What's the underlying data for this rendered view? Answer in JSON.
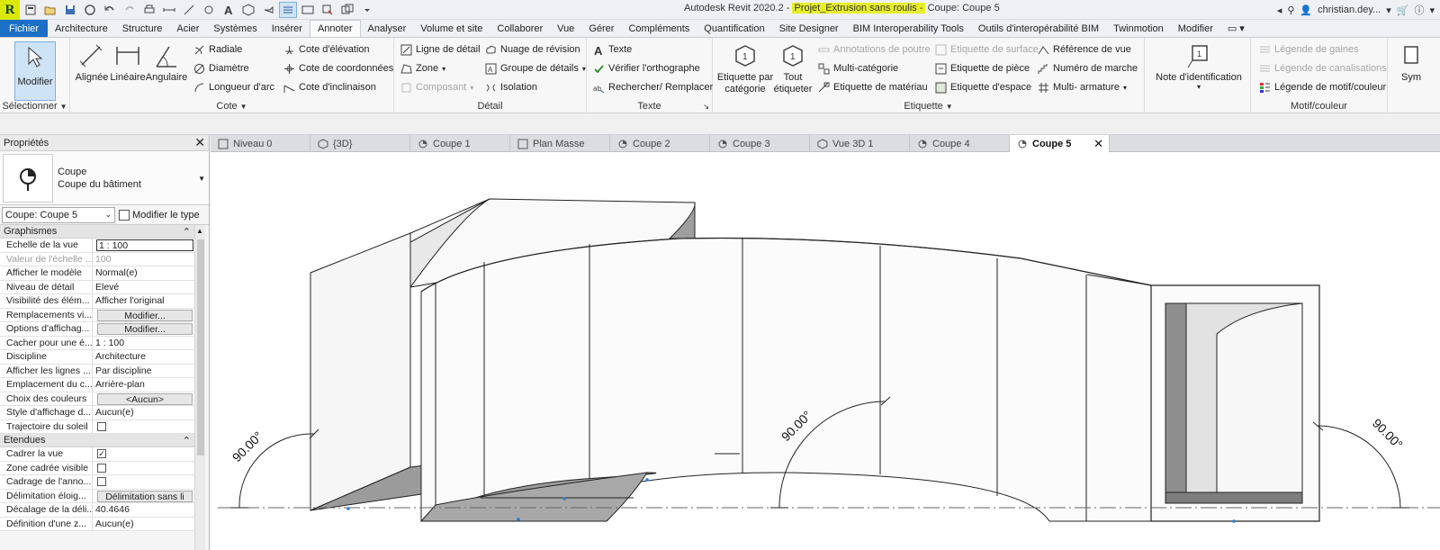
{
  "window": {
    "title_prefix": "Autodesk Revit 2020.2 - ",
    "title_project": "Projet_Extrusion sans roulis -",
    "title_view": " Coupe: Coupe 5",
    "user": "christian.dey...",
    "app_logo": "R"
  },
  "menu": [
    "Fichier",
    "Architecture",
    "Structure",
    "Acier",
    "Systèmes",
    "Insérer",
    "Annoter",
    "Analyser",
    "Volume et site",
    "Collaborer",
    "Vue",
    "Gérer",
    "Compléments",
    "Quantification",
    "Site Designer",
    "BIM Interoperability Tools",
    "Outils d'interopérabilité BIM",
    "Twinmotion",
    "Modifier"
  ],
  "ribbon": {
    "select": {
      "modify": "Modifier",
      "label": "Sélectionner"
    },
    "cote": {
      "aligned": "Alignée",
      "linear": "Linéaire",
      "angular": "Angulaire",
      "radial": "Radiale",
      "diameter": "Diamètre",
      "arc_length": "Longueur d'arc",
      "spot_elevation": "Cote d'élévation",
      "spot_coordinate": "Cote de coordonnées",
      "spot_slope": "Cote d'inclinaison",
      "label": "Cote"
    },
    "detail": {
      "detail_line": "Ligne de détail",
      "region": "Zone",
      "component": "Composant",
      "revision_cloud": "Nuage de révision",
      "detail_group": "Groupe de détails",
      "insulation": "Isolation",
      "label": "Détail"
    },
    "text": {
      "text": "Texte",
      "spell": "Vérifier l'orthographe",
      "find": "Rechercher/ Remplacer",
      "label": "Texte"
    },
    "tag": {
      "by_category": "Etiquette par catégorie",
      "tag_all": "Tout étiqueter",
      "beam_annotations": "Annotations de poutre",
      "multi_category": "Multi-catégorie",
      "material_tag": "Etiquette de matériau",
      "area_tag": "Etiquette de surface",
      "room_tag": "Etiquette de pièce",
      "space_tag": "Etiquette d'espace",
      "view_reference": "Référence de vue",
      "tread_number": "Numéro de marche",
      "multi_rebar": "Multi- armature",
      "label": "Etiquette"
    },
    "keynote": {
      "keynote": "Note d'identification"
    },
    "color_fill": {
      "duct_legend": "Légende de gaines",
      "pipe_legend": "Légende de canalisations",
      "pattern_legend": "Légende de motif/couleur",
      "label": "Motif/couleur",
      "symbol": "Sym"
    }
  },
  "properties": {
    "title": "Propriétés",
    "type_name": "Coupe",
    "type_sub": "Coupe du bâtiment",
    "instance": "Coupe: Coupe 5",
    "edit_type": "Modifier le type",
    "groups": [
      {
        "name": "Graphismes",
        "rows": [
          {
            "name": "Echelle de la vue",
            "value": "1 : 100",
            "kind": "input"
          },
          {
            "name": "Valeur de l'échelle ...",
            "value": "100",
            "kind": "disabled"
          },
          {
            "name": "Afficher le modèle",
            "value": "Normal(e)"
          },
          {
            "name": "Niveau de détail",
            "value": "Elevé"
          },
          {
            "name": "Visibilité des élém...",
            "value": "Afficher l'original"
          },
          {
            "name": "Remplacements vi...",
            "value": "Modifier...",
            "kind": "button"
          },
          {
            "name": "Options d'affichag...",
            "value": "Modifier...",
            "kind": "button"
          },
          {
            "name": "Cacher pour une é...",
            "value": "1 : 100"
          },
          {
            "name": "Discipline",
            "value": "Architecture"
          },
          {
            "name": "Afficher les lignes ...",
            "value": "Par discipline"
          },
          {
            "name": "Emplacement du c...",
            "value": "Arrière-plan"
          },
          {
            "name": "Choix des couleurs",
            "value": "<Aucun>",
            "kind": "button"
          },
          {
            "name": "Style d'affichage d...",
            "value": "Aucun(e)"
          },
          {
            "name": "Trajectoire du soleil",
            "value": "",
            "kind": "check",
            "checked": false
          }
        ]
      },
      {
        "name": "Etendues",
        "rows": [
          {
            "name": "Cadrer la vue",
            "value": "",
            "kind": "check",
            "checked": true
          },
          {
            "name": "Zone cadrée visible",
            "value": "",
            "kind": "check",
            "checked": false
          },
          {
            "name": "Cadrage de l'anno...",
            "value": "",
            "kind": "check",
            "checked": false
          },
          {
            "name": "Délimitation éloig...",
            "value": "Délimitation sans li",
            "kind": "button"
          },
          {
            "name": "Décalage de la déli...",
            "value": "40.4646"
          },
          {
            "name": "Définition d'une z...",
            "value": "Aucun(e)"
          }
        ]
      }
    ]
  },
  "view_tabs": [
    {
      "label": "Niveau 0",
      "icon": "plan-icon"
    },
    {
      "label": "{3D}",
      "icon": "3d-icon"
    },
    {
      "label": "Coupe 1",
      "icon": "section-icon"
    },
    {
      "label": "Plan Masse",
      "icon": "plan-icon"
    },
    {
      "label": "Coupe 2",
      "icon": "section-icon"
    },
    {
      "label": "Coupe 3",
      "icon": "section-icon"
    },
    {
      "label": "Vue 3D 1",
      "icon": "3d-icon"
    },
    {
      "label": "Coupe 4",
      "icon": "section-icon"
    },
    {
      "label": "Coupe 5",
      "icon": "section-icon",
      "active": true
    }
  ],
  "canvas": {
    "angle_labels": [
      "90.00°",
      "90.00°",
      "90.00°"
    ]
  }
}
